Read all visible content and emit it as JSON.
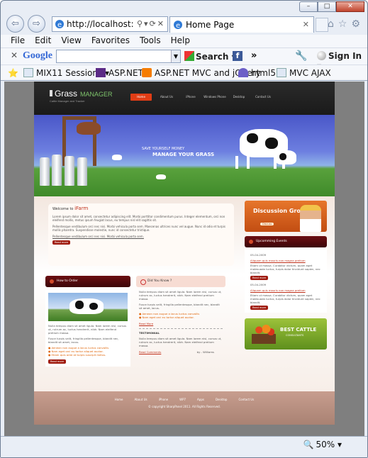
{
  "browser": {
    "address": "http://localhost:",
    "tab_title": "Home Page",
    "menu": [
      "File",
      "Edit",
      "View",
      "Favorites",
      "Tools",
      "Help"
    ],
    "google_logo": "Google",
    "search_label": "Search",
    "more_label": "»",
    "signin_label": "Sign In",
    "favorites": [
      "MIX11 Sessions",
      "ASP.NET",
      "ASP.NET MVC and jQuery",
      "html5",
      "MVC AJAX"
    ],
    "zoom": "50%"
  },
  "site": {
    "logo_main": "Grass",
    "logo_manager": "MANAGER",
    "logo_tag": "Cattle Manager and Tracker",
    "nav": [
      "Home",
      "About Us",
      "iPhone",
      "Windows Phone",
      "Desktop",
      "Contact Us"
    ],
    "banner_line1": "SAVE YOURSELF MONEY",
    "banner_line2": "MANAGE YOUR GRASS",
    "welcome_title": "Welcome to",
    "welcome_brand": "iFarm",
    "welcome_p1": "Lorem ipsum dolor sit amet, consectetur adipiscing elit. Morbi porttitor condimentum purus. Integer elementum, orci non eleifend mollis, metus ipsum feugiat lacus, eu tempus nisl elit sagittis sit.",
    "welcome_p2": "Pellentesque vestibulum orci nec nisi. Morbi vehicula porta sem. Maecenas ultrices nunc vel augue. Nunc id odio et turpis mollis pharetra. Suspendisse molestie, nunc id consectetur tristique.",
    "welcome_p3": "Pellentesque vestibulum orci nec nisi. Morbi vehicula porta sem.",
    "read_more": "Read more",
    "howto_title": "How to Order",
    "howto_text": "Nulla tempus diam sit amet ligula. Nam lorem nisl, cursus ut, rutrum ac, luctus hendrerit, nibh. Nam eleifend pretium massa.",
    "howto_text2": "Fusce turpis velit, fringilla pellentesque, blandit nec, blandit sit amet, lacus.",
    "howto_list": [
      "Aenean non augue a lacus luctus convallis",
      "Nam eget orci eu tortor aliquet auctor.",
      "Etiam quis ante at turpis suscipit metus."
    ],
    "didyou_title": "Did You Know ?",
    "didyou_text": "Nulla tempus diam sit amet ligula. Nam lorem nisl, cursus ut, rutrum ac, luctus hendrerit, nibh. Nam eleifend pretium massa.",
    "didyou_text2": "Fusce turpis velit, fringilla pellentesque, blandit nec, blandit sit amet, lacus.",
    "didyou_list": [
      "Aenean non augue a lacus luctus convallis",
      "Nam eget orci eu tortor aliquet auctor."
    ],
    "read_more2": "Read More",
    "testimonial_title": "TESTIMONIAL",
    "testimonial_text": "Nulla tempus diam sit amet ligula. Nam lorem nisl, cursus ut, rutrum ac, luctus hendrerit, nibh. Nam eleifend pretium massa.",
    "read_comments": "Read Comments",
    "testimonial_by": "by - Williams",
    "discussion_title": "Discussion Groups",
    "discussion_btn": "Discuss",
    "events_title": "Upcomming Events",
    "events": [
      {
        "date": "05-04-2009",
        "title": "Aliquam quis mauris non magna pretium",
        "text": "Etiam ut massa. Curabitur dictum, quam eget malesuada luctus, turpis dolor tincidunt sapien, nec blandit."
      },
      {
        "date": "05-04-2009",
        "title": "Aliquam quis mauris non magna pretium",
        "text": "Etiam ut massa. Curabitur dictum, quam eget malesuada luctus, turpis dolor tincidunt sapien, nec blandit."
      },
      {
        "date": "05-04-2009",
        "title": "Aliquam quis mauris non magna pretium",
        "text": "Etiam ut massa. Curabitur dictum, quam eget malesuada luctus, turpis dolor tincidunt sapien, nec blandit."
      }
    ],
    "cattle_title": "BEST CATTLE",
    "cattle_sub": "CONSULTANTS",
    "footer_nav": [
      "Home",
      "About Us",
      "iPhone",
      "WP7",
      "Apps",
      "Desktop",
      "Contact Us"
    ],
    "copyright": "© copyright SharpPanel 2011. All Rights Reserved."
  }
}
